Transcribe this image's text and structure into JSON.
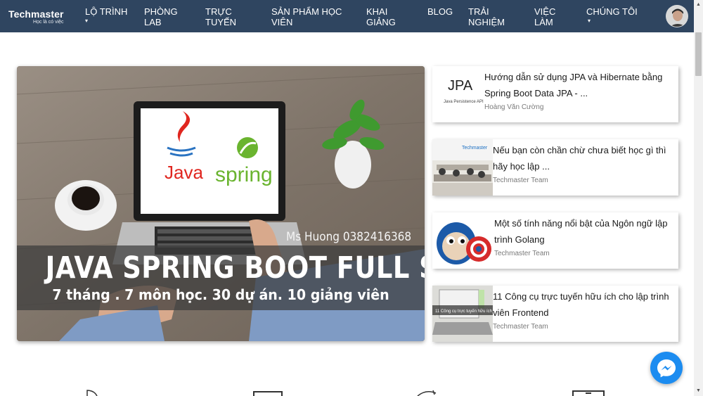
{
  "brand": {
    "title": "Techmaster",
    "tagline": "Học là có việc"
  },
  "nav": {
    "items": [
      {
        "line1": "Lộ trình",
        "line2": "",
        "caret": true
      },
      {
        "line1": "Phòng",
        "line2": "Lab",
        "caret": false
      },
      {
        "line1": "Trực",
        "line2": "tuyến",
        "caret": false
      },
      {
        "line1": "Sản phẩm học",
        "line2": "viên",
        "caret": false
      },
      {
        "line1": "Khai",
        "line2": "giảng",
        "caret": false
      },
      {
        "line1": "Blog",
        "line2": "",
        "caret": false
      },
      {
        "line1": "Trải",
        "line2": "nghiệm",
        "caret": false
      },
      {
        "line1": "Việc",
        "line2": "làm",
        "caret": false
      },
      {
        "line1": "Chúng tôi",
        "line2": "",
        "caret": true
      }
    ],
    "caret_glyph": "▾"
  },
  "hero": {
    "logo_java": "Java",
    "logo_spring": "spring",
    "contact": "Ms Huong 0382416368",
    "title": "JAVA SPRING BOOT FULL STACK",
    "subtitle": "7 tháng . 7 môn học. 30 dự án. 10 giảng viên"
  },
  "articles": [
    {
      "title": "Hướng dẫn sử dụng JPA và Hibernate bằng Spring Boot Data JPA - ...",
      "author": "Hoàng Văn Cường",
      "thumb_text": "JPA",
      "thumb_caption": "Java Persistence API"
    },
    {
      "title": "Nếu bạn còn chần chừ chưa biết học gì thì hãy học lập ...",
      "author": "Techmaster Team",
      "thumb_text": "Techmaster",
      "thumb_caption": ""
    },
    {
      "title": "Một số tính năng nổi bật của Ngôn ngữ lập trình Golang",
      "author": "Techmaster Team",
      "thumb_text": "",
      "thumb_caption": ""
    },
    {
      "title": "11 Công cụ trực tuyến hữu ích cho lập trình viên Frontend",
      "author": "Techmaster Team",
      "thumb_text": "",
      "thumb_caption": "11 Công cụ trực tuyến hữu ích"
    }
  ],
  "icons": {
    "messenger": "messenger-icon",
    "avatar": "user-avatar"
  },
  "colors": {
    "navbar": "#2f4560",
    "messenger": "#1c8cf0"
  }
}
